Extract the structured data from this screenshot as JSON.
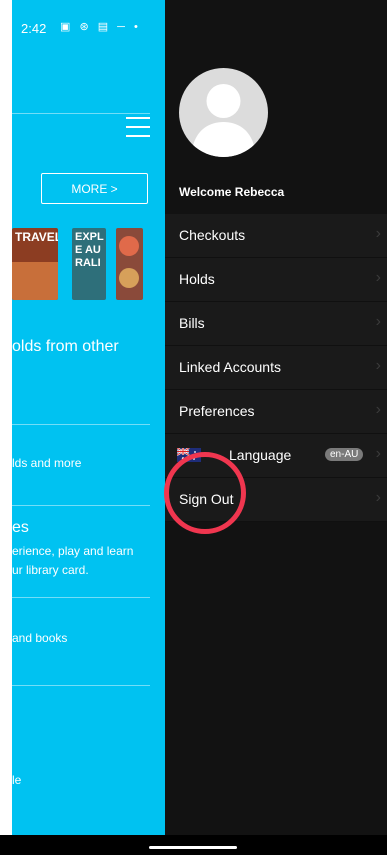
{
  "status_bar": {
    "time": "2:42",
    "left_icons": "▣ ⊛ ▤ ─ •",
    "right_icons": "◷ ☰ ♥ ◢ ◢ ▮"
  },
  "background": {
    "more_label": "MORE >",
    "book1_text": "TRAVEL",
    "book2_text": "EXPL\nE AU\nRALI",
    "holds_text": "olds from other",
    "holds_more_text": "lds and more",
    "section_title": "es",
    "section_line1": "erience, play and learn",
    "section_line2": "ur library card.",
    "books_text": "and books",
    "bottom_text": "le"
  },
  "drawer": {
    "welcome": "Welcome Rebecca",
    "menu": [
      {
        "label": "Checkouts"
      },
      {
        "label": "Holds"
      },
      {
        "label": "Bills"
      },
      {
        "label": "Linked Accounts"
      },
      {
        "label": "Preferences"
      },
      {
        "label": "Language",
        "badge": "en-AU"
      },
      {
        "label": "Sign Out"
      }
    ]
  },
  "colors": {
    "app_blue": "#00c2f1",
    "drawer": "#121212",
    "highlight": "#f0364f"
  }
}
